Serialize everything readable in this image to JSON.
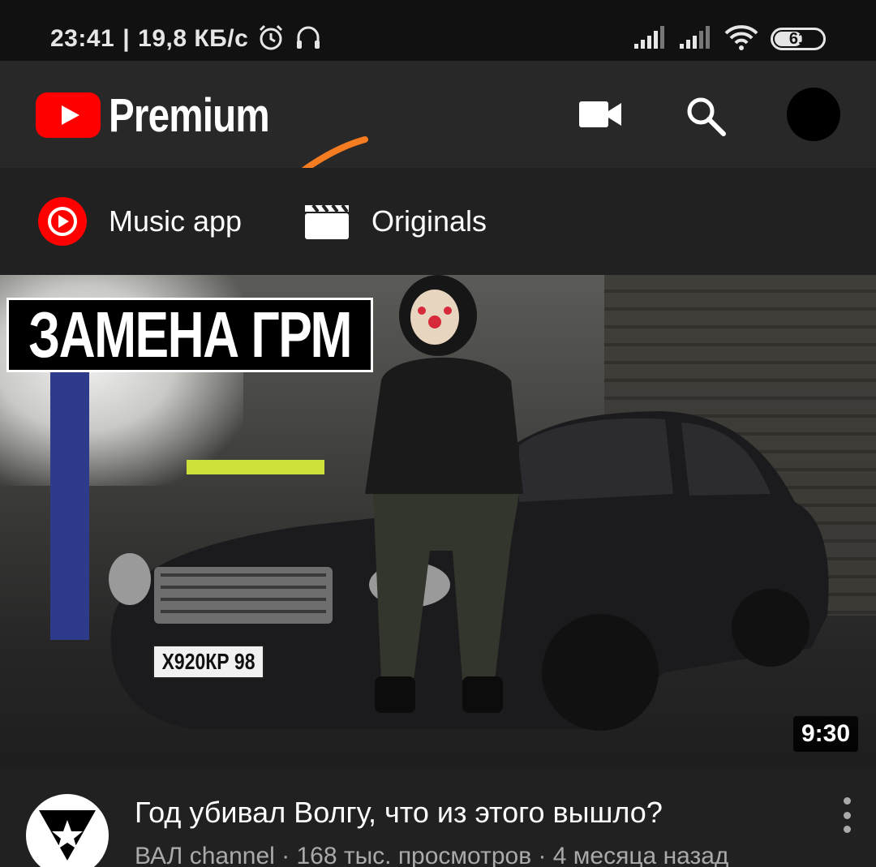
{
  "status_bar": {
    "time": "23:41",
    "separator": "|",
    "net_speed": "19,8 КБ/с",
    "battery_level": "61",
    "battery_fraction": 0.61,
    "icons": [
      "alarm-icon",
      "headset-icon",
      "signal-icon",
      "signal-icon",
      "wifi-icon",
      "battery-icon"
    ]
  },
  "header": {
    "brand": "Premium",
    "logo_icon": "youtube-logo-icon",
    "actions": [
      "camera-icon",
      "search-icon",
      "account-avatar"
    ],
    "annotation_color": "#f57c20"
  },
  "chips": [
    {
      "label": "Music app",
      "icon": "music-app-icon"
    },
    {
      "label": "Originals",
      "icon": "clapperboard-icon"
    }
  ],
  "video": {
    "thumbnail_caption": "ЗАМЕНА ГРМ",
    "license_plate": "Х920КР 98",
    "duration": "9:30",
    "title": "Год убивал Волгу, что из этого вышло?",
    "info": "ВАЛ channel · 168 тыс. просмотров · 4 месяца назад"
  },
  "colors": {
    "brand_red": "#ff0000",
    "background": "#212121",
    "app_bar": "#282828",
    "status_bar": "#111111"
  }
}
